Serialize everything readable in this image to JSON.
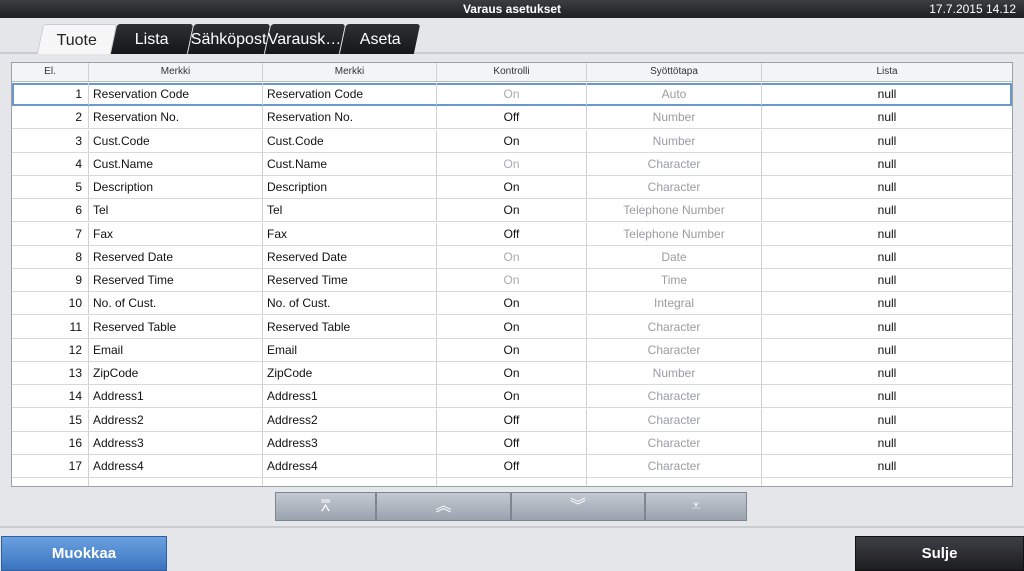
{
  "titlebar": {
    "title": "Varaus asetukset",
    "clock": "17.7.2015 14.12"
  },
  "tabs": [
    {
      "label": "Tuote",
      "active": true
    },
    {
      "label": "Lista",
      "active": false
    },
    {
      "label": "Sähköpost",
      "active": false
    },
    {
      "label": "Varausk…",
      "active": false
    },
    {
      "label": "Aseta",
      "active": false
    }
  ],
  "grid": {
    "headers": [
      "El.",
      "Merkki",
      "Merkki",
      "Kontrolli",
      "Syöttötapa",
      "Lista"
    ],
    "rows": [
      {
        "num": "1",
        "m1": "Reservation Code",
        "m2": "Reservation Code",
        "k": "On",
        "s": "Auto",
        "l": "null",
        "k_dim": true,
        "selected": true
      },
      {
        "num": "2",
        "m1": "Reservation No.",
        "m2": "Reservation No.",
        "k": "Off",
        "s": "Number",
        "l": "null",
        "k_dim": false
      },
      {
        "num": "3",
        "m1": "Cust.Code",
        "m2": "Cust.Code",
        "k": "On",
        "s": "Number",
        "l": "null",
        "k_dim": false
      },
      {
        "num": "4",
        "m1": "Cust.Name",
        "m2": "Cust.Name",
        "k": "On",
        "s": "Character",
        "l": "null",
        "k_dim": true
      },
      {
        "num": "5",
        "m1": "Description",
        "m2": "Description",
        "k": "On",
        "s": "Character",
        "l": "null",
        "k_dim": false
      },
      {
        "num": "6",
        "m1": "Tel",
        "m2": "Tel",
        "k": "On",
        "s": "Telephone Number",
        "l": "null",
        "k_dim": false
      },
      {
        "num": "7",
        "m1": "Fax",
        "m2": "Fax",
        "k": "Off",
        "s": "Telephone Number",
        "l": "null",
        "k_dim": false
      },
      {
        "num": "8",
        "m1": "Reserved Date",
        "m2": "Reserved Date",
        "k": "On",
        "s": "Date",
        "l": "null",
        "k_dim": true
      },
      {
        "num": "9",
        "m1": "Reserved Time",
        "m2": "Reserved Time",
        "k": "On",
        "s": "Time",
        "l": "null",
        "k_dim": true
      },
      {
        "num": "10",
        "m1": "No. of Cust.",
        "m2": "No. of Cust.",
        "k": "On",
        "s": "Integral",
        "l": "null",
        "k_dim": false
      },
      {
        "num": "11",
        "m1": "Reserved Table",
        "m2": "Reserved Table",
        "k": "On",
        "s": "Character",
        "l": "null",
        "k_dim": false
      },
      {
        "num": "12",
        "m1": "Email",
        "m2": "Email",
        "k": "On",
        "s": "Character",
        "l": "null",
        "k_dim": false
      },
      {
        "num": "13",
        "m1": "ZipCode",
        "m2": "ZipCode",
        "k": "On",
        "s": "Number",
        "l": "null",
        "k_dim": false
      },
      {
        "num": "14",
        "m1": "Address1",
        "m2": "Address1",
        "k": "On",
        "s": "Character",
        "l": "null",
        "k_dim": false
      },
      {
        "num": "15",
        "m1": "Address2",
        "m2": "Address2",
        "k": "Off",
        "s": "Character",
        "l": "null",
        "k_dim": false
      },
      {
        "num": "16",
        "m1": "Address3",
        "m2": "Address3",
        "k": "Off",
        "s": "Character",
        "l": "null",
        "k_dim": false
      },
      {
        "num": "17",
        "m1": "Address4",
        "m2": "Address4",
        "k": "Off",
        "s": "Character",
        "l": "null",
        "k_dim": false
      },
      {
        "num": "",
        "m1": "",
        "m2": "",
        "k": "",
        "s": "",
        "l": "",
        "k_dim": false
      }
    ]
  },
  "scroll_buttons": [
    {
      "name": "scroll-top-icon",
      "glyph": "⩞"
    },
    {
      "name": "page-up-icon",
      "glyph": "︽"
    },
    {
      "name": "page-down-icon",
      "glyph": "︾"
    },
    {
      "name": "scroll-bottom-icon",
      "glyph": "⩡"
    }
  ],
  "buttons": {
    "edit": "Muokkaa",
    "close": "Sulje"
  },
  "colors": {
    "accent": "#3a74bf",
    "selection": "#6b97c9"
  }
}
